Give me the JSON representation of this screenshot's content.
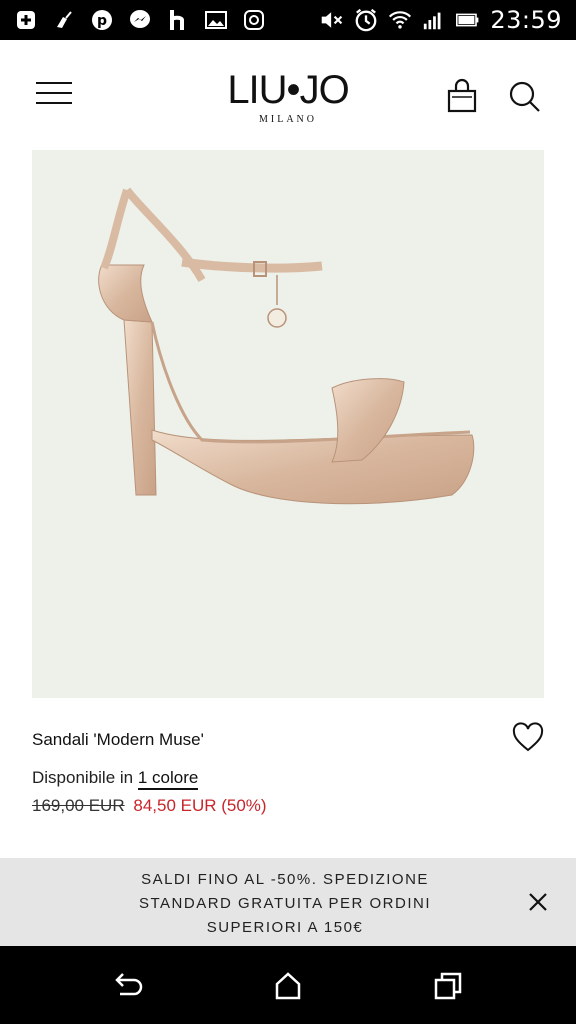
{
  "status_bar": {
    "time": "23:59",
    "left_icons": [
      "plus-icon",
      "cleaner-icon",
      "pinterest-icon",
      "messenger-icon",
      "h-app-icon",
      "image-icon",
      "instagram-icon"
    ],
    "right_icons": [
      "mute-icon",
      "alarm-icon",
      "wifi-icon",
      "signal-icon",
      "battery-icon"
    ]
  },
  "header": {
    "logo_main": "LIU•JO",
    "logo_sub": "MILANO"
  },
  "product": {
    "name": "Sandali 'Modern Muse'",
    "availability_prefix": "Disponibile in ",
    "availability_link": "1 colore",
    "old_price": "169,00 EUR",
    "new_price": "84,50 EUR (50%)",
    "image_bg": "#eef1ea",
    "shoe_color": "#e2c7b0"
  },
  "banner": {
    "line1": "SALDI FINO AL -50%. SPEDIZIONE",
    "line2": "STANDARD GRATUITA PER ORDINI",
    "line3": "SUPERIORI A 150€"
  },
  "colors": {
    "price_sale": "#c8262b",
    "banner_bg": "#e5e5e5"
  }
}
